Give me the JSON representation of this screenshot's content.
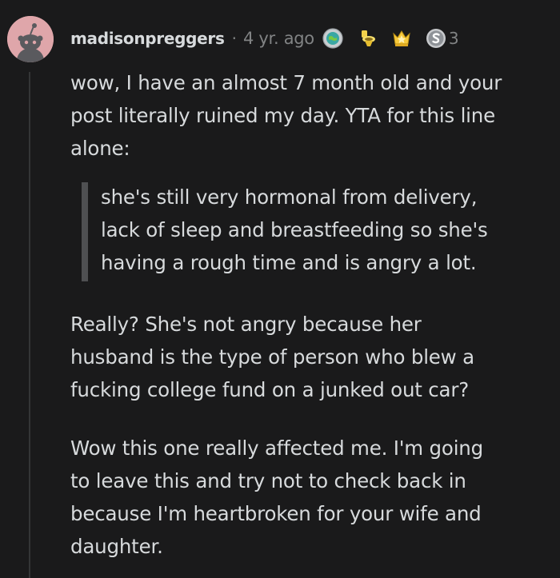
{
  "comment": {
    "username": "madisonpreggers",
    "separator": "·",
    "timestamp": "4 yr. ago",
    "awards": [
      {
        "icon": "globe-award-icon"
      },
      {
        "icon": "toilet-award-icon"
      },
      {
        "icon": "crown-star-award-icon"
      },
      {
        "icon": "silver-award-icon",
        "count": "3"
      }
    ],
    "paragraphs": [
      "wow, I have an almost 7 month old and your\npost literally ruined my day. YTA for this line\nalone:",
      "Really? She's not angry because her\nhusband is the type of person who blew a\nfucking college fund on a junked out car?",
      "Wow this one really affected me. I'm going\nto leave this and try not to check back in\nbecause I'm heartbroken for your wife and\ndaughter."
    ],
    "quote": "she's still very hormonal from delivery,\nlack of sleep and breastfeeding so she's\nhaving a rough time and is angry a lot."
  },
  "colors": {
    "background": "#1a1a1b",
    "text": "#d7dadc",
    "meta": "#818384",
    "avatar_bg": "#dfa6aa",
    "quote_bar": "#4f5052"
  }
}
